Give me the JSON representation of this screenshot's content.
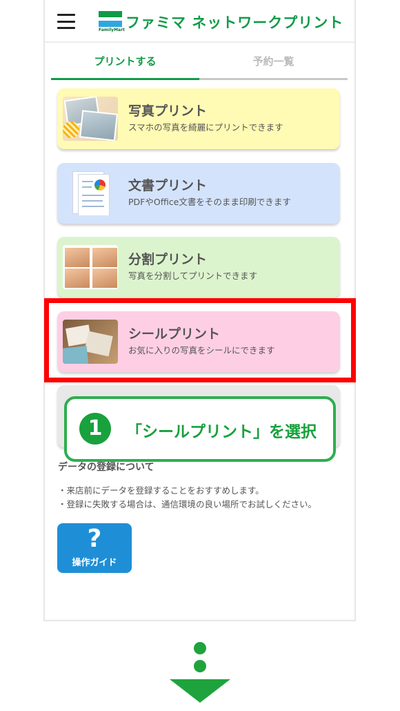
{
  "header": {
    "brand_name": "ファミマ ネットワークプリント",
    "logo_caption": "FamilyMart"
  },
  "tabs": [
    {
      "label": "プリントする",
      "active": true
    },
    {
      "label": "予約一覧",
      "active": false
    }
  ],
  "cards": [
    {
      "title": "写真プリント",
      "description": "スマホの写真を綺麗にプリントできます",
      "color": "#fffab4"
    },
    {
      "title": "文書プリント",
      "description": "PDFやOffice文書をそのまま印刷できます",
      "color": "#d4e3fc"
    },
    {
      "title": "分割プリント",
      "description": "写真を分割してプリントできます",
      "color": "#dcf4cd"
    },
    {
      "title": "シールプリント",
      "description": "お気に入りの写真をシールにできます",
      "color": "#fecfe4"
    }
  ],
  "callout": {
    "step_number": "1",
    "text": "「シールプリント」を選択"
  },
  "info": {
    "title": "データの登録について",
    "lines": [
      "・来店前にデータを登録することをおすすめします。",
      "・登録に失敗する場合は、通信環境の良い場所でお試しください。"
    ]
  },
  "guide_button": {
    "symbol": "?",
    "label": "操作ガイド"
  },
  "colors": {
    "brand_green": "#0f9b48",
    "highlight_red": "#ff0000",
    "callout_green": "#18a13d",
    "guide_blue": "#1e8fd6"
  }
}
